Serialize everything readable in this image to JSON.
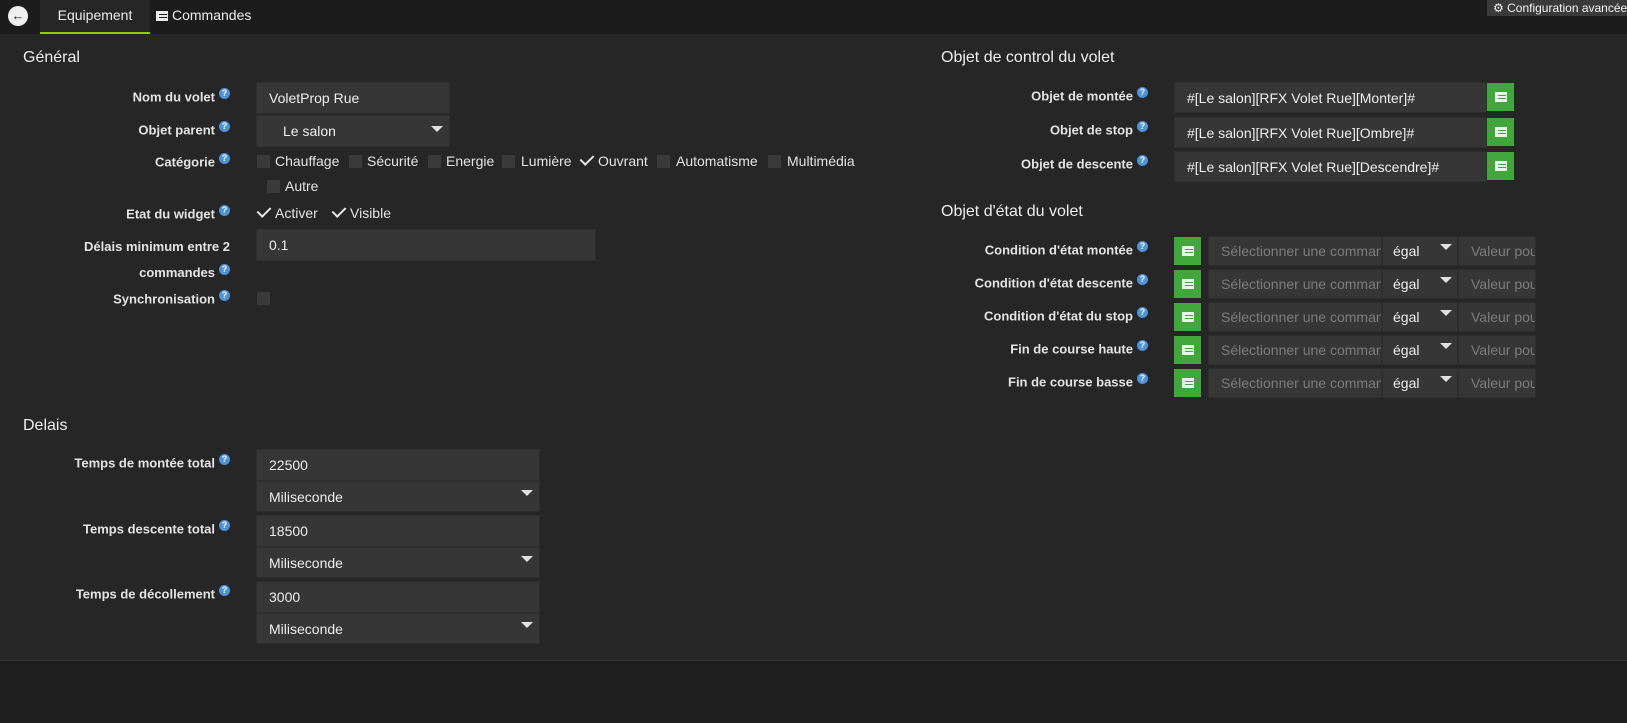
{
  "tabs": {
    "equipment": "Equipement",
    "commands": "Commandes",
    "advanced": "Configuration avancée"
  },
  "general": {
    "title": "Général",
    "name_label": "Nom du volet",
    "name_value": "VoletProp Rue",
    "parent_label": "Objet parent",
    "parent_value": "Le salon",
    "category_label": "Catégorie",
    "categories": [
      {
        "label": "Chauffage",
        "checked": false
      },
      {
        "label": "Sécurité",
        "checked": false
      },
      {
        "label": "Energie",
        "checked": false
      },
      {
        "label": "Lumière",
        "checked": false
      },
      {
        "label": "Ouvrant",
        "checked": true
      },
      {
        "label": "Automatisme",
        "checked": false
      },
      {
        "label": "Multimédia",
        "checked": false
      },
      {
        "label": "Autre",
        "checked": false
      }
    ],
    "widget_label": "Etat du widget",
    "activate_label": "Activer",
    "visible_label": "Visible",
    "delay_label_1": "Délais minimum entre 2",
    "delay_label_2": "commandes",
    "delay_value": "0.1",
    "sync_label": "Synchronisation"
  },
  "delais": {
    "title": "Delais",
    "rise_label": "Temps de montée total",
    "rise_value": "22500",
    "rise_unit": "Miliseconde",
    "descent_label": "Temps descente total",
    "descent_value": "18500",
    "descent_unit": "Miliseconde",
    "unstick_label": "Temps de décollement",
    "unstick_value": "3000",
    "unstick_unit": "Miliseconde"
  },
  "control": {
    "title": "Objet de control du volet",
    "up_label": "Objet de montée",
    "up_value": "#[Le salon][RFX Volet Rue][Monter]#",
    "stop_label": "Objet de stop",
    "stop_value": "#[Le salon][RFX Volet Rue][Ombre]#",
    "down_label": "Objet de descente",
    "down_value": "#[Le salon][RFX Volet Rue][Descendre]#"
  },
  "state": {
    "title": "Objet d'état du volet",
    "rows": [
      {
        "label": "Condition d'état montée",
        "cmd_placeholder": "Sélectionner une commande",
        "operator": "égal",
        "value_placeholder": "Valeur pour"
      },
      {
        "label": "Condition d'état descente",
        "cmd_placeholder": "Sélectionner une commande",
        "operator": "égal",
        "value_placeholder": "Valeur pour"
      },
      {
        "label": "Condition d'état du stop",
        "cmd_placeholder": "Sélectionner une commande",
        "operator": "égal",
        "value_placeholder": "Valeur pour"
      },
      {
        "label": "Fin de course haute",
        "cmd_placeholder": "Sélectionner une commande",
        "operator": "égal",
        "value_placeholder": "Valeur pour"
      },
      {
        "label": "Fin de course basse",
        "cmd_placeholder": "Sélectionner une commande",
        "operator": "égal",
        "value_placeholder": "Valeur pour"
      }
    ]
  },
  "help_glyph": "?",
  "colors": {
    "accent": "#94ca02",
    "button_green": "#41a63b",
    "help_blue": "#4e92d8",
    "background": "#262626"
  }
}
